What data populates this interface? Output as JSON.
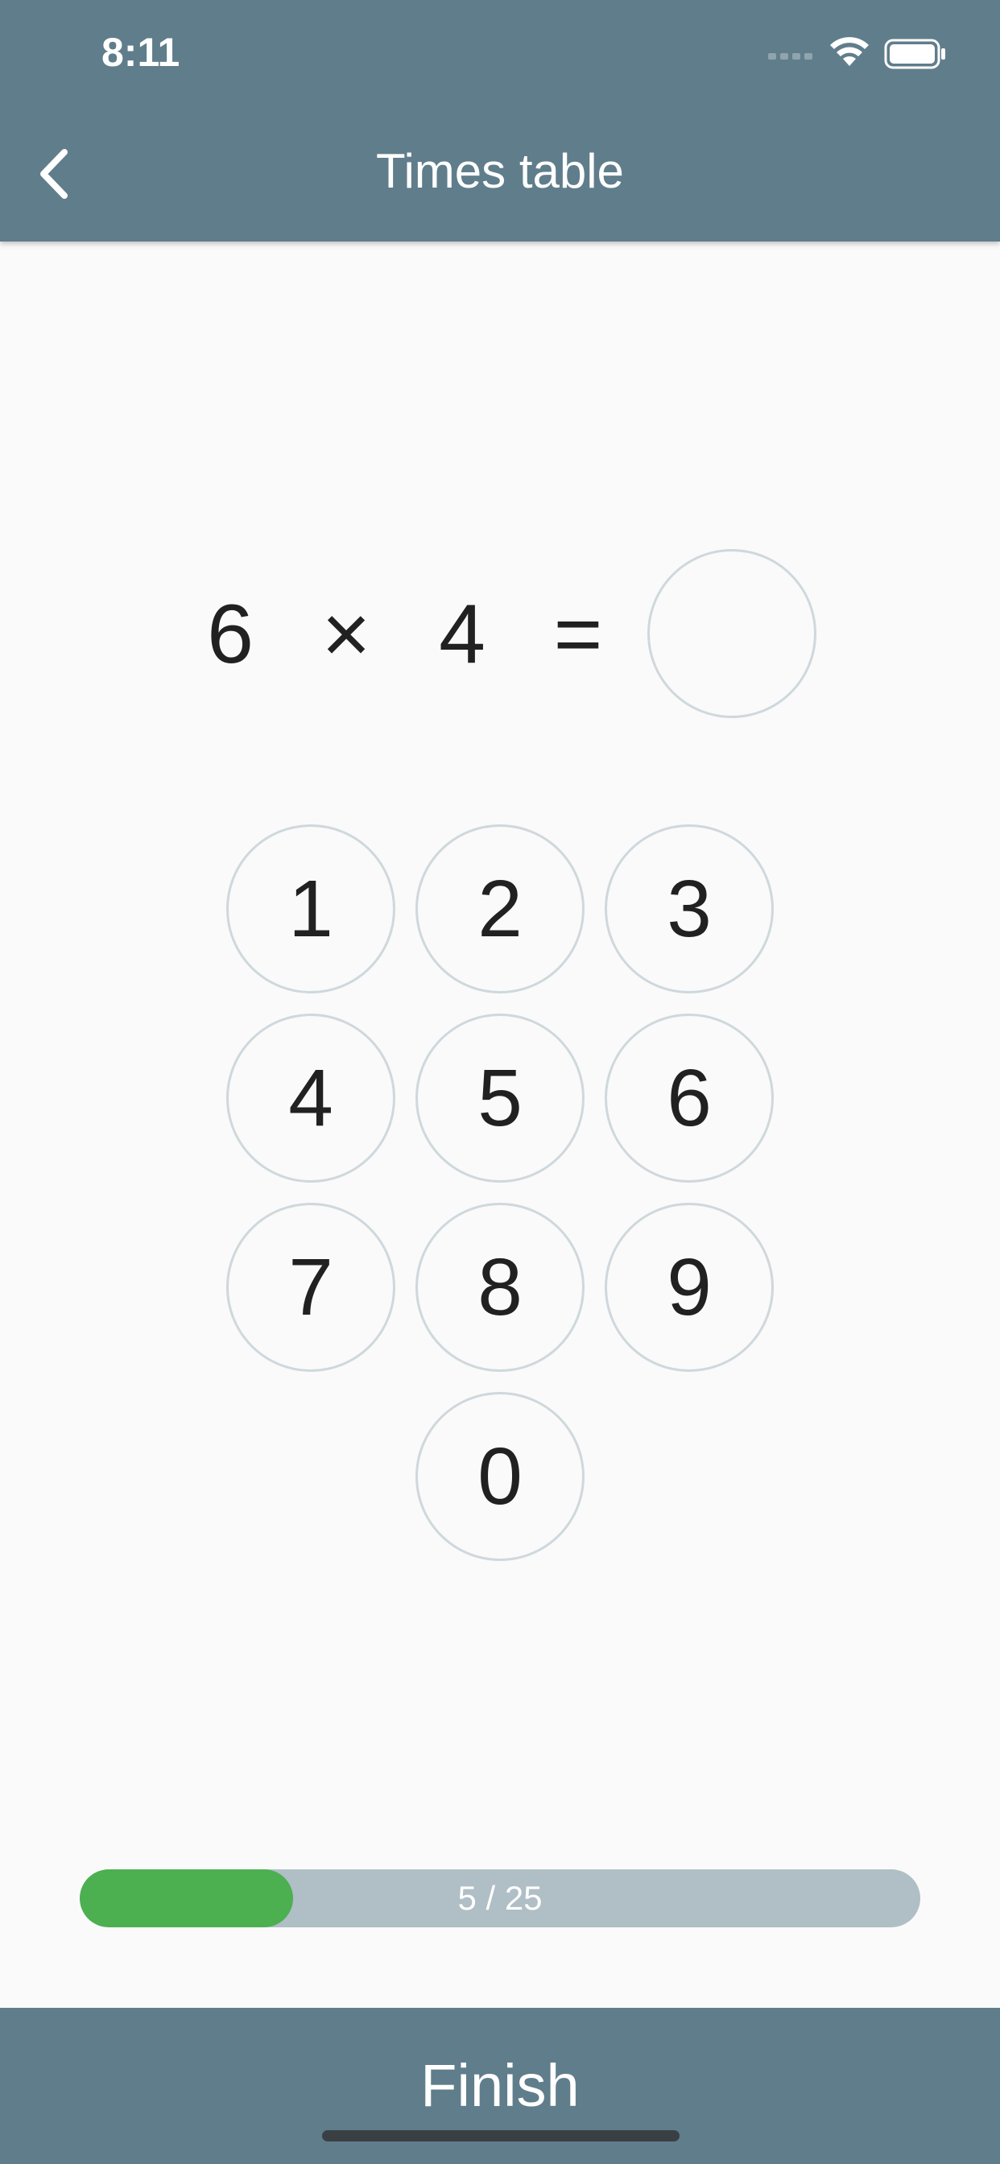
{
  "status_bar": {
    "time": "8:11",
    "icons": [
      "signal-icon",
      "wifi-icon",
      "battery-icon"
    ]
  },
  "header": {
    "title": "Times table",
    "back_icon": "chevron-left-icon"
  },
  "equation": {
    "left": "6",
    "operator": "×",
    "right": "4",
    "equals": "=",
    "answer": ""
  },
  "keypad": {
    "keys": [
      "1",
      "2",
      "3",
      "4",
      "5",
      "6",
      "7",
      "8",
      "9",
      "0"
    ]
  },
  "progress": {
    "label": "5 / 25",
    "current": 5,
    "total": 25
  },
  "finish": {
    "label": "Finish"
  },
  "colors": {
    "primary": "#607d8b",
    "progress_fill": "#4caf50",
    "progress_track": "#b0bec5",
    "circle_border": "#cfd8dc",
    "background": "#fafafa"
  }
}
